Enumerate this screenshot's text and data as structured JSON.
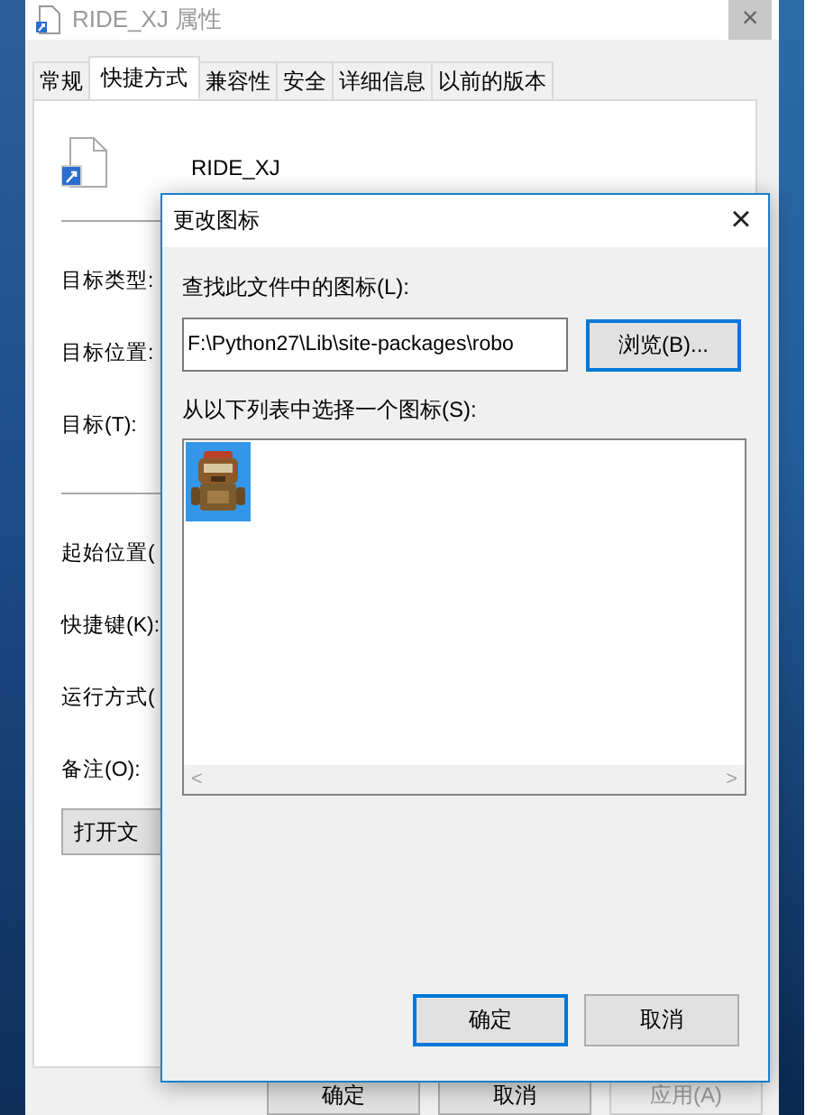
{
  "window": {
    "title": "RIDE_XJ 属性",
    "close": "×"
  },
  "tabs": [
    {
      "label": "常规",
      "selected": false
    },
    {
      "label": "快捷方式",
      "selected": true
    },
    {
      "label": "兼容性",
      "selected": false
    },
    {
      "label": "安全",
      "selected": false
    },
    {
      "label": "详细信息",
      "selected": false
    },
    {
      "label": "以前的版本",
      "selected": false
    }
  ],
  "shortcut_name": "RIDE_XJ",
  "fields": [
    {
      "label": "目标类型:",
      "divider_before": false
    },
    {
      "label": "目标位置:",
      "divider_before": false
    },
    {
      "label": "目标(T):",
      "divider_before": false
    },
    {
      "label": "起始位置(",
      "divider_before": true
    },
    {
      "label": "快捷键(K):",
      "divider_before": false
    },
    {
      "label": "运行方式(",
      "divider_before": false
    },
    {
      "label": "备注(O):",
      "divider_before": false
    }
  ],
  "open_location_button": "打开文",
  "buttons": [
    {
      "label": "确定",
      "disabled": false
    },
    {
      "label": "取消",
      "disabled": false
    },
    {
      "label": "应用(A)",
      "disabled": true
    }
  ],
  "dialog": {
    "title": "更改图标",
    "close": "×",
    "file_label": "查找此文件中的图标(L):",
    "file_value": "F:\\Python27\\Lib\\site-packages\\robo",
    "browse_button": "浏览(B)...",
    "list_label": "从以下列表中选择一个图标(S):",
    "icons": [
      {
        "selected": true
      }
    ],
    "scroll_left": "<",
    "scroll_right": ">",
    "buttons": [
      {
        "label": "确定",
        "default": true
      },
      {
        "label": "取消",
        "default": false
      }
    ]
  }
}
